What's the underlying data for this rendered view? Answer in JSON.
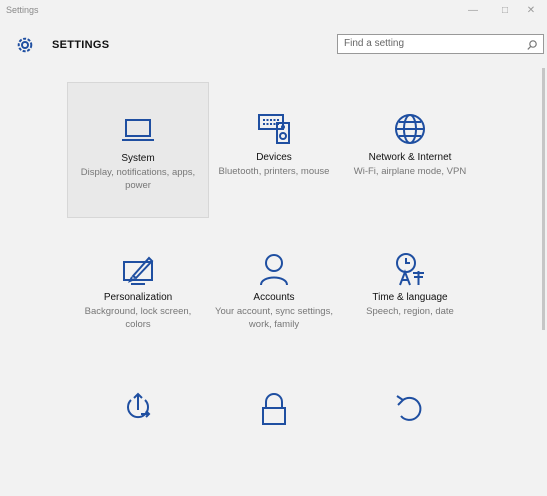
{
  "window": {
    "title": "Settings",
    "controls": {
      "minimize": "—",
      "maximize": "□",
      "close": "✕"
    }
  },
  "header": {
    "title": "SETTINGS",
    "search": {
      "placeholder": "Find a setting"
    }
  },
  "tiles": [
    {
      "name": "system",
      "title": "System",
      "description": "Display, notifications, apps, power",
      "icon": "laptop-icon",
      "selected": true
    },
    {
      "name": "devices",
      "title": "Devices",
      "description": "Bluetooth, printers, mouse",
      "icon": "devices-icon"
    },
    {
      "name": "network",
      "title": "Network & Internet",
      "description": "Wi-Fi, airplane mode, VPN",
      "icon": "globe-icon"
    },
    {
      "name": "personalization",
      "title": "Personalization",
      "description": "Background, lock screen, colors",
      "icon": "paint-icon"
    },
    {
      "name": "accounts",
      "title": "Accounts",
      "description": "Your account, sync settings, work, family",
      "icon": "person-icon"
    },
    {
      "name": "time-language",
      "title": "Time & language",
      "description": "Speech, region, date",
      "icon": "time-language-icon"
    },
    {
      "name": "ease-of-access",
      "title": "",
      "description": "",
      "icon": "ease-of-access-icon"
    },
    {
      "name": "privacy",
      "title": "",
      "description": "",
      "icon": "lock-icon"
    },
    {
      "name": "update-security",
      "title": "",
      "description": "",
      "icon": "refresh-icon"
    }
  ],
  "colors": {
    "accent": "#1f4fa1",
    "background": "#f2f2f2",
    "selected_tile": "#e9e9e9"
  }
}
